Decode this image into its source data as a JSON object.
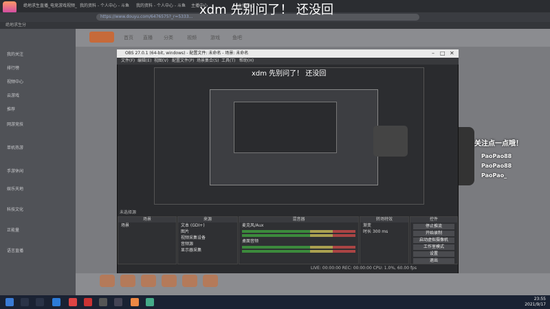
{
  "browser": {
    "tabs": [
      {
        "label": "绝地求生直播_电竞游戏视频_"
      },
      {
        "label": "我的资料 - 个人中心 - 斗鱼"
      },
      {
        "label": "我的资料 - 个人中心 - 斗鱼"
      },
      {
        "label": "主播中心"
      },
      {
        "label": "主播中心"
      }
    ],
    "url": "https://www.douyu.com/6476575?_r=5333...",
    "bookmark": "绝地求生分"
  },
  "overlay_caption": "xdm 先别问了！ 还没回",
  "douyu": {
    "nav": [
      "首页",
      "直播",
      "分类",
      "视频",
      "游戏",
      "鱼吧"
    ],
    "sidebar": [
      "我的关注",
      "排行榜",
      "视频中心",
      "云游戏",
      "推荐",
      "网游竞技",
      "单机热游",
      "手游休闲",
      "娱乐天地",
      "科技文化",
      "正能量",
      "语言直播"
    ],
    "handles": [
      "PaoPao88",
      "PaoPao88",
      "PaoPao_"
    ],
    "follow_banner": "关注点一点哦！"
  },
  "obs": {
    "title": "OBS 27.0.1 (64-bit, windows) - 配置文件: 未命名 - 场景: 未命名",
    "menu": [
      "文件(F)",
      "编辑(E)",
      "视图(V)",
      "配置文件(P)",
      "场景集合(S)",
      "工具(T)",
      "帮助(H)"
    ],
    "source_hint": "未选择源",
    "scenes": {
      "title": "场景",
      "items": [
        "场景"
      ]
    },
    "sources": {
      "title": "来源",
      "items": [
        "文本 (GDI+)",
        "图片",
        "视频采集设备",
        "音频源",
        "显示器采集"
      ]
    },
    "mixer": {
      "title": "混音器",
      "channels": [
        {
          "name": "麦克风/Aux"
        },
        {
          "name": "桌面音频"
        }
      ]
    },
    "transitions": {
      "title": "转场特效",
      "type": "渐变",
      "duration_label": "时长",
      "duration": "300 ms"
    },
    "controls": {
      "title": "控件",
      "buttons": [
        "停止推流",
        "开始录制",
        "启动虚拟摄像机",
        "工作室模式",
        "设置",
        "退出"
      ]
    },
    "status": "LIVE: 00:00:00   REC: 00:00:00   CPU: 1.0%, 60.00 fps"
  },
  "taskbar": {
    "time": "23:55",
    "date": "2021/9/17"
  },
  "colors": {
    "accent": "#ff6a00",
    "obs_bg": "#2a2b2e",
    "taskbar": "#1a2233"
  }
}
